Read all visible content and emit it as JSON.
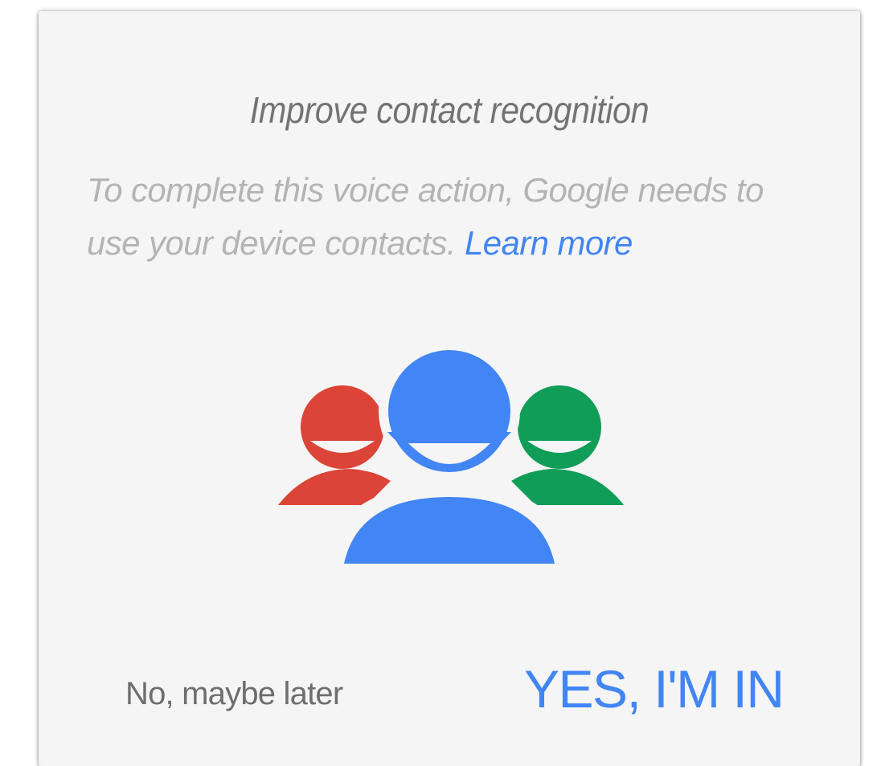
{
  "dialog": {
    "title": "Improve contact recognition",
    "message": "To complete this voice action, Google needs to use your device contacts.",
    "learn_more_label": "Learn more",
    "illustration": {
      "icon": "contacts-group-icon",
      "colors": {
        "left_person": "#db4437",
        "center_person": "#4285f4",
        "right_person": "#0f9d58"
      }
    },
    "decline_label": "No, maybe later",
    "accept_label": "YES, I'M IN"
  },
  "colors": {
    "card_background": "#f5f5f5",
    "title_text": "#737373",
    "body_text": "#b4b4b4",
    "accent": "#4285f4"
  }
}
